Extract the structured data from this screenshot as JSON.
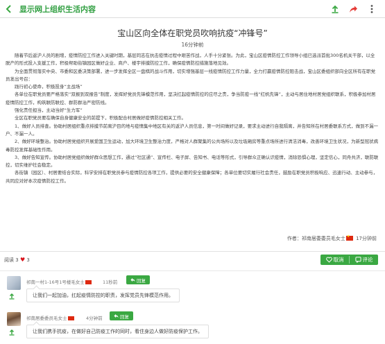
{
  "header": {
    "title": "显示网上组织生活内容",
    "icons": [
      "back-arrow-icon",
      "download-icon",
      "share-icon",
      "more-icon"
    ]
  },
  "article": {
    "title": "宝山区向全体在职党员吹响抗疫“冲锋号”",
    "time": "16分钟前",
    "paragraphs": [
      "随着节后返沪人员的剧增，疫情防控工作进入关键时期，基层同志在抗击疫情过程中艰苦作战，人手十分紧张。为此，宝山区疫情防控工作领导小组已选派首批300名机关干部，以全脱产的形式投入支援工作，积极帮助街镇园区做好企业、商户、楼宇排摸防控工作，确保疫情防控措施落地见效。",
      "为全面贯彻落实中央、市委和区委决策部署，进一步发挥全区一盘棋的战斗作用，切实增强基层一线疫情防控工作力量，全力打赢疫情防控阻击战，宝山区委组织部向全区所有在职党员发出号召：",
      "践行初心使命，积极投身“主战场”",
      "各单位在职党员要严格落实“双报到双报告”制度，发挥好党员先锋模范作用，坚决扛起疫情防控的应尽之责，争当防疫一线“红帆先锋”，主动与居住地村居党组织联系，积极参加村居疫情防控工作，构筑联防联控、群防群治严密防线。",
      "强化责任担当，主动当好“生力军”",
      "全区在职党员要在确保自身健康安全的前提下，积极配合村居做好疫情防控相关工作。",
      "1、做好人员排查。协助村居组织重点排摸节前离沪目的地与疫情集中地区有关的返沪人员信息，第一时间做好记录，要求主动进行自我隔离，并告知所在村居委联系方式，做到不漏一户、不漏一人。",
      "2、做好环境整治。协助村居党组织开展爱国卫生运动，加大环境卫生整治力度，严格对人群聚集的公共场所以及垃圾厢房等重点场所进行清洁消毒，改善环境卫生状况，为新型冠状病毒防控发挥基础性作用。",
      "3、做好告知宣传。协助村居党组织做好群众思想工作，通过“社区通”、宣传栏、电子屏、告知书、电话等形式，引导群众正确认识疫情，消除恐惧心理，坚定信心，同舟共济，联防联控，切实维护社会稳定。",
      "各街镇（园区）、村居要结合实际，科学安排在职党员参与疫情防控各项工作，提供必要的安全健康保障；各单位要切实履行社会责任，鼓励在职党员积极响应、迅速行动、主动参与，共同应对好本次疫情防控工作。"
    ],
    "author_prefix": "作者：",
    "author": "祁南居委委员毛女士",
    "author_time": "17分钟前"
  },
  "stats": {
    "read_label": "阅读",
    "read_count": "3",
    "likes": "3"
  },
  "actions": {
    "cancel": "取消",
    "comment": "评论"
  },
  "comments": [
    {
      "name": "祁南一村1-16号1号楼毛女士",
      "time": "11秒前",
      "reply": "回复",
      "text": "让我们一起加油，扛起疫情防控的职责，发挥党员先锋模范作用。"
    },
    {
      "name": "祁南居委委员毛女士",
      "time": "4分钟前",
      "reply": "回复",
      "text": "让我们携手抗疫，在做好自己防疫工作的同时，看住身边人做好防疫保护工作。"
    }
  ],
  "colors": {
    "accent_green": "#3aa842",
    "heart_red": "#d8141c",
    "flag_red": "#de2910"
  }
}
